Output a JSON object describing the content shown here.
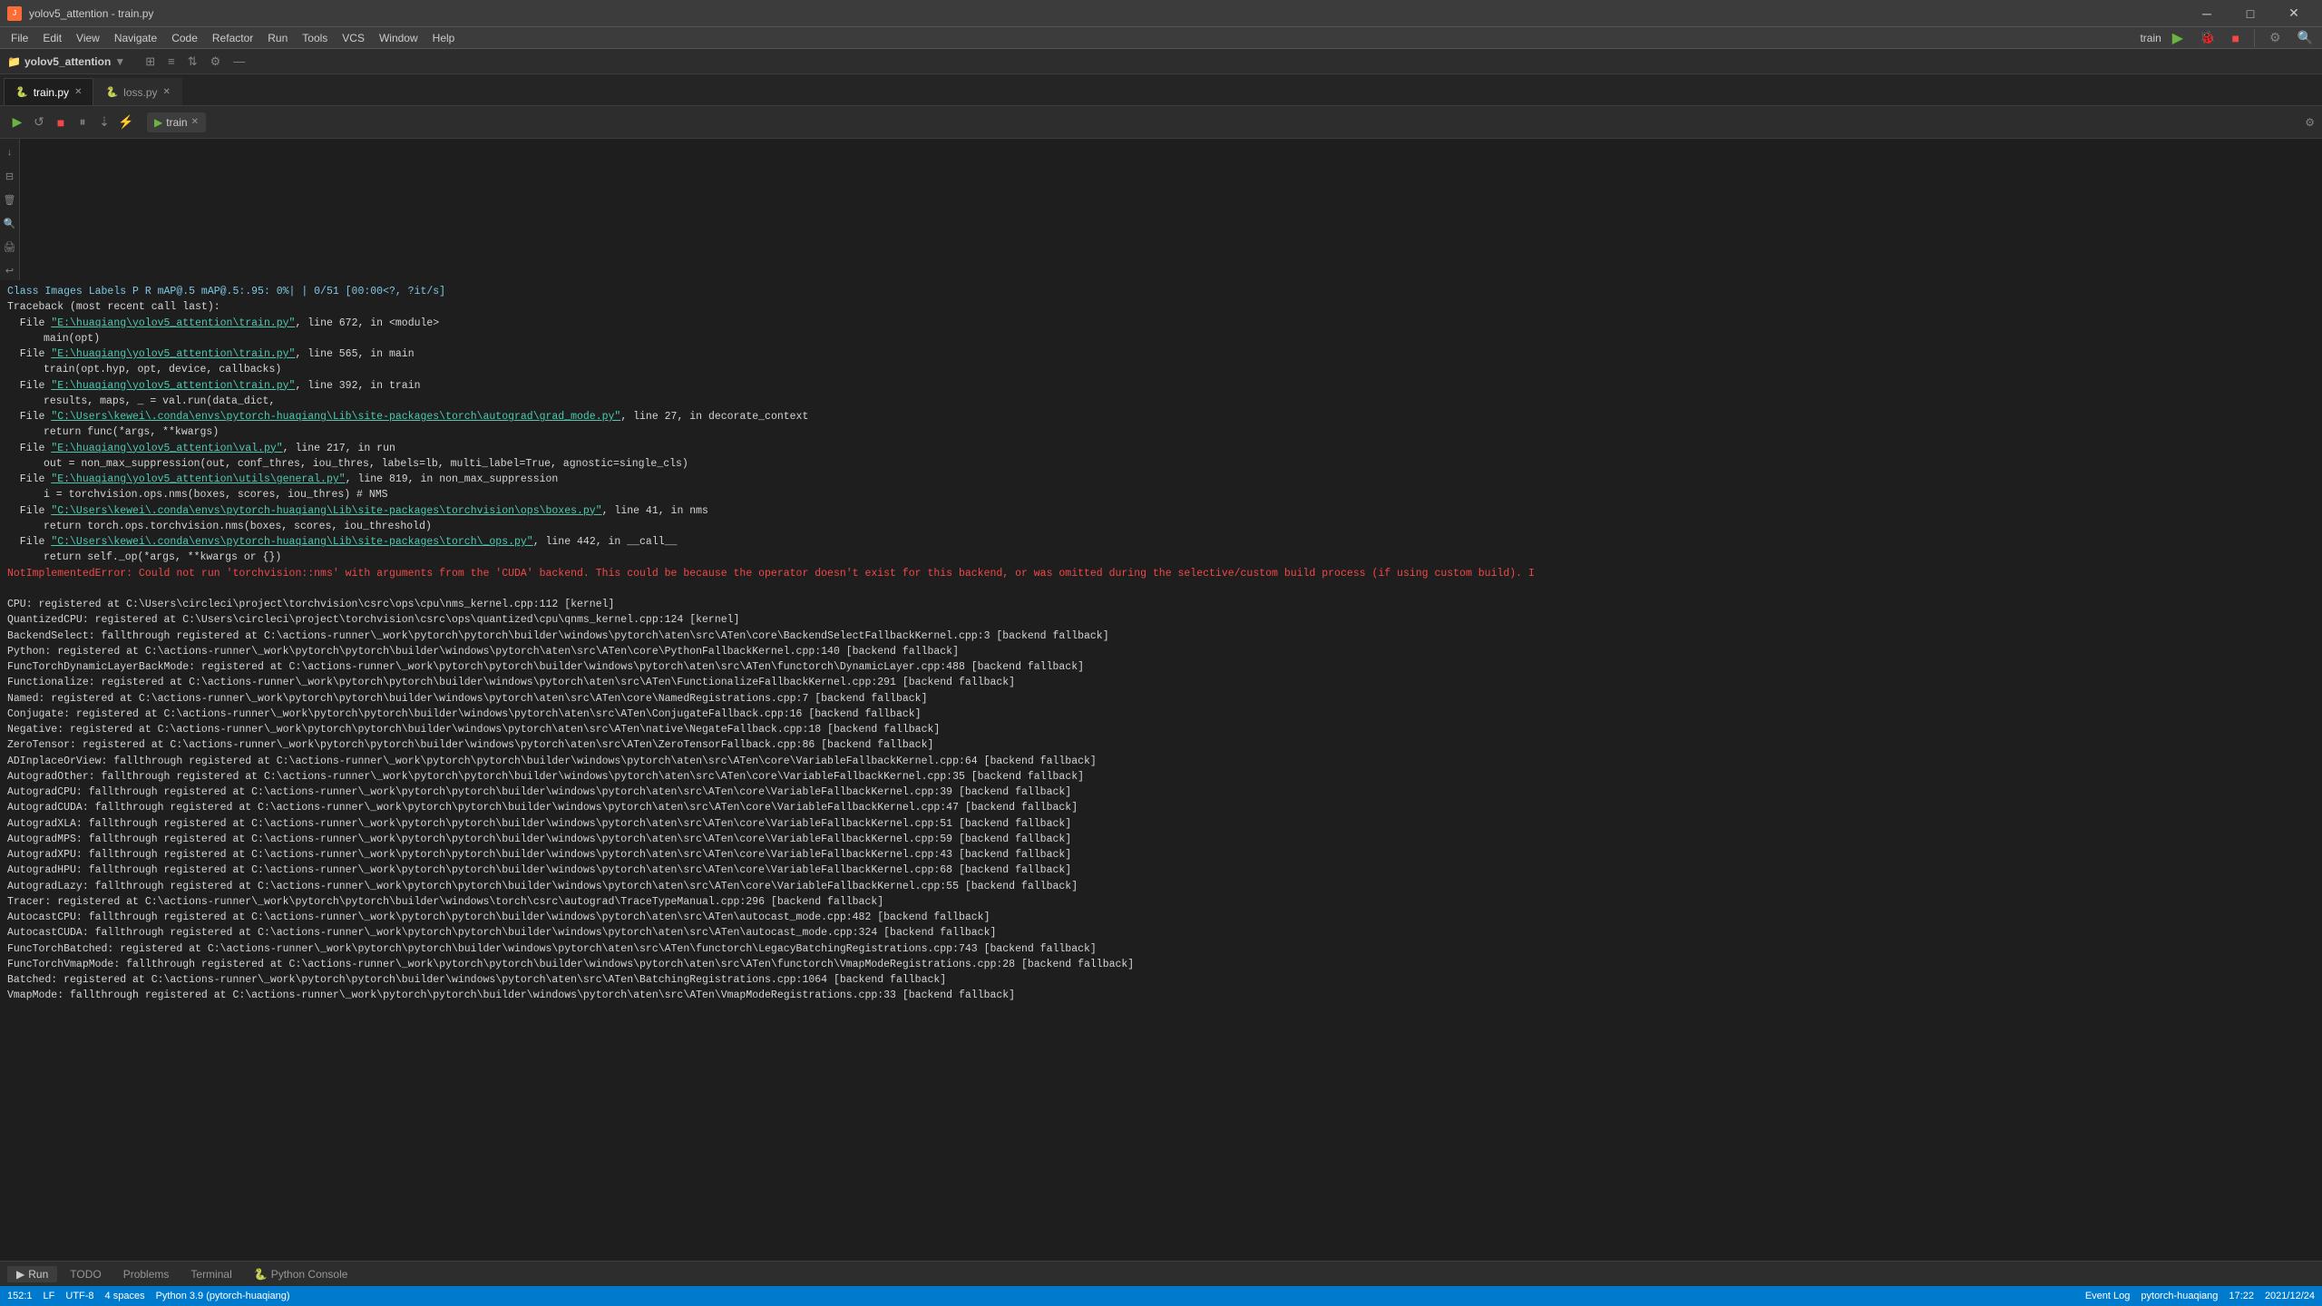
{
  "window": {
    "title": "yolov5_attention - train.py",
    "app_name": "yolov5_attention",
    "file_name": "train.py"
  },
  "menu": {
    "items": [
      "File",
      "Edit",
      "View",
      "Navigate",
      "Code",
      "Refactor",
      "Run",
      "Tools",
      "VCS",
      "Window",
      "Help"
    ]
  },
  "tabs": [
    {
      "label": "train.py",
      "icon": "py",
      "active": true
    },
    {
      "label": "loss.py",
      "icon": "py",
      "active": false
    }
  ],
  "run_panel": {
    "tab_label": "train",
    "run_label": "Run",
    "gear_label": "⚙"
  },
  "run_config": {
    "name": "train",
    "run_icon": "▶",
    "stop_icon": "■",
    "debug_icon": "🐛",
    "settings_icon": "⚙"
  },
  "output": {
    "header": "          Class     Images     Labels          P          R     mAP@.5  mAP@.5:.95:   0%|          | 0/51 [00:00<?, ?it/s]",
    "lines": [
      {
        "type": "normal",
        "text": "Traceback (most recent call last):"
      },
      {
        "type": "file-link",
        "prefix": "  File ",
        "link": "\"E:\\huaqiang\\yolov5_attention\\train.py\"",
        "suffix": ", line 672, in <module>"
      },
      {
        "type": "indent",
        "text": "main(opt)"
      },
      {
        "type": "file-link",
        "prefix": "  File ",
        "link": "\"E:\\huaqiang\\yolov5_attention\\train.py\"",
        "suffix": ", line 565, in main"
      },
      {
        "type": "indent",
        "text": "train(opt.hyp, opt, device, callbacks)"
      },
      {
        "type": "file-link",
        "prefix": "  File ",
        "link": "\"E:\\huaqiang\\yolov5_attention\\train.py\"",
        "suffix": ", line 392, in train"
      },
      {
        "type": "indent",
        "text": "results, maps, _ = val.run(data_dict,"
      },
      {
        "type": "file-link",
        "prefix": "  File ",
        "link": "\"C:\\Users\\kewei\\.conda\\envs\\pytorch-huaqiang\\Lib\\site-packages\\torch\\autograd\\grad_mode.py\"",
        "suffix": ", line 27, in decorate_context"
      },
      {
        "type": "indent",
        "text": "return func(*args, **kwargs)"
      },
      {
        "type": "file-link",
        "prefix": "  File ",
        "link": "\"E:\\huaqiang\\yolov5_attention\\val.py\"",
        "suffix": ", line 217, in run"
      },
      {
        "type": "indent",
        "text": "out = non_max_suppression(out, conf_thres, iou_thres, labels=lb, multi_label=True, agnostic=single_cls)"
      },
      {
        "type": "file-link",
        "prefix": "  File ",
        "link": "\"E:\\huaqiang\\yolov5_attention\\utils\\general.py\"",
        "suffix": ", line 819, in non_max_suppression"
      },
      {
        "type": "indent",
        "text": "i = torchvision.ops.nms(boxes, scores, iou_thres)  # NMS"
      },
      {
        "type": "file-link",
        "prefix": "  File ",
        "link": "\"C:\\Users\\kewei\\.conda\\envs\\pytorch-huaqiang\\Lib\\site-packages\\torchvision\\ops\\boxes.py\"",
        "suffix": ", line 41, in nms"
      },
      {
        "type": "indent",
        "text": "return torch.ops.torchvision.nms(boxes, scores, iou_threshold)"
      },
      {
        "type": "file-link",
        "prefix": "  File ",
        "link": "\"C:\\Users\\kewei\\.conda\\envs\\pytorch-huaqiang\\Lib\\site-packages\\torch\\_ops.py\"",
        "suffix": ", line 442, in __call__"
      },
      {
        "type": "indent",
        "text": "return self._op(*args, **kwargs or {})"
      },
      {
        "type": "error",
        "text": "NotImplementedError: Could not run 'torchvision::nms' with arguments from the 'CUDA' backend. This could be because the operator doesn't exist for this backend, or was omitted during the selective/custom build process (if using custom build). I"
      },
      {
        "type": "blank"
      },
      {
        "type": "reg",
        "text": "CPU: registered at C:\\Users\\circleci\\project\\torchvision\\csrc\\ops\\cpu\\nms_kernel.cpp:112 [kernel]"
      },
      {
        "type": "reg",
        "text": "QuantizedCPU: registered at C:\\Users\\circleci\\project\\torchvision\\csrc\\ops\\quantized\\cpu\\qnms_kernel.cpp:124 [kernel]"
      },
      {
        "type": "reg",
        "text": "BackendSelect: fallthrough registered at C:\\actions-runner\\_work\\pytorch\\pytorch\\builder\\windows\\pytorch\\aten\\src\\ATen\\core\\BackendSelectFallbackKernel.cpp:3 [backend fallback]"
      },
      {
        "type": "reg",
        "text": "Python: registered at C:\\actions-runner\\_work\\pytorch\\pytorch\\builder\\windows\\pytorch\\aten\\src\\ATen\\core\\PythonFallbackKernel.cpp:140 [backend fallback]"
      },
      {
        "type": "reg",
        "text": "FuncTorchDynamicLayerBackMode: registered at C:\\actions-runner\\_work\\pytorch\\pytorch\\builder\\windows\\pytorch\\aten\\src\\ATen\\functorch\\DynamicLayer.cpp:488 [backend fallback]"
      },
      {
        "type": "reg",
        "text": "Functionalize: registered at C:\\actions-runner\\_work\\pytorch\\pytorch\\builder\\windows\\pytorch\\aten\\src\\ATen\\FunctionalizeFallbackKernel.cpp:291 [backend fallback]"
      },
      {
        "type": "reg",
        "text": "Named: registered at C:\\actions-runner\\_work\\pytorch\\pytorch\\builder\\windows\\pytorch\\aten\\src\\ATen\\core\\NamedRegistrations.cpp:7 [backend fallback]"
      },
      {
        "type": "reg",
        "text": "Conjugate: registered at C:\\actions-runner\\_work\\pytorch\\pytorch\\builder\\windows\\pytorch\\aten\\src\\ATen\\ConjugateFallback.cpp:16 [backend fallback]"
      },
      {
        "type": "reg",
        "text": "Negative: registered at C:\\actions-runner\\_work\\pytorch\\pytorch\\builder\\windows\\pytorch\\aten\\src\\ATen\\native\\NegateFallback.cpp:18 [backend fallback]"
      },
      {
        "type": "reg",
        "text": "ZeroTensor: registered at C:\\actions-runner\\_work\\pytorch\\pytorch\\builder\\windows\\pytorch\\aten\\src\\ATen\\ZeroTensorFallback.cpp:86 [backend fallback]"
      },
      {
        "type": "reg",
        "text": "ADInplaceOrView: fallthrough registered at C:\\actions-runner\\_work\\pytorch\\pytorch\\builder\\windows\\pytorch\\aten\\src\\ATen\\core\\VariableFallbackKernel.cpp:64 [backend fallback]"
      },
      {
        "type": "reg",
        "text": "AutogradOther: fallthrough registered at C:\\actions-runner\\_work\\pytorch\\pytorch\\builder\\windows\\pytorch\\aten\\src\\ATen\\core\\VariableFallbackKernel.cpp:35 [backend fallback]"
      },
      {
        "type": "reg",
        "text": "AutogradCPU: fallthrough registered at C:\\actions-runner\\_work\\pytorch\\pytorch\\builder\\windows\\pytorch\\aten\\src\\ATen\\core\\VariableFallbackKernel.cpp:39 [backend fallback]"
      },
      {
        "type": "reg",
        "text": "AutogradCUDA: fallthrough registered at C:\\actions-runner\\_work\\pytorch\\pytorch\\builder\\windows\\pytorch\\aten\\src\\ATen\\core\\VariableFallbackKernel.cpp:47 [backend fallback]"
      },
      {
        "type": "reg",
        "text": "AutogradXLA: fallthrough registered at C:\\actions-runner\\_work\\pytorch\\pytorch\\builder\\windows\\pytorch\\aten\\src\\ATen\\core\\VariableFallbackKernel.cpp:51 [backend fallback]"
      },
      {
        "type": "reg",
        "text": "AutogradMPS: fallthrough registered at C:\\actions-runner\\_work\\pytorch\\pytorch\\builder\\windows\\pytorch\\aten\\src\\ATen\\core\\VariableFallbackKernel.cpp:59 [backend fallback]"
      },
      {
        "type": "reg",
        "text": "AutogradXPU: fallthrough registered at C:\\actions-runner\\_work\\pytorch\\pytorch\\builder\\windows\\pytorch\\aten\\src\\ATen\\core\\VariableFallbackKernel.cpp:43 [backend fallback]"
      },
      {
        "type": "reg",
        "text": "AutogradHPU: fallthrough registered at C:\\actions-runner\\_work\\pytorch\\pytorch\\builder\\windows\\pytorch\\aten\\src\\ATen\\core\\VariableFallbackKernel.cpp:68 [backend fallback]"
      },
      {
        "type": "reg",
        "text": "AutogradLazy: fallthrough registered at C:\\actions-runner\\_work\\pytorch\\pytorch\\builder\\windows\\pytorch\\aten\\src\\ATen\\core\\VariableFallbackKernel.cpp:55 [backend fallback]"
      },
      {
        "type": "reg",
        "text": "Tracer: registered at C:\\actions-runner\\_work\\pytorch\\pytorch\\builder\\windows\\torch\\csrc\\autograd\\TraceTypeManual.cpp:296 [backend fallback]"
      },
      {
        "type": "reg",
        "text": "AutocastCPU: fallthrough registered at C:\\actions-runner\\_work\\pytorch\\pytorch\\builder\\windows\\pytorch\\aten\\src\\ATen\\autocast_mode.cpp:482 [backend fallback]"
      },
      {
        "type": "reg",
        "text": "AutocastCUDA: fallthrough registered at C:\\actions-runner\\_work\\pytorch\\pytorch\\builder\\windows\\pytorch\\aten\\src\\ATen\\autocast_mode.cpp:324 [backend fallback]"
      },
      {
        "type": "reg",
        "text": "FuncTorchBatched: registered at C:\\actions-runner\\_work\\pytorch\\pytorch\\builder\\windows\\pytorch\\aten\\src\\ATen\\functorch\\LegacyBatchingRegistrations.cpp:743 [backend fallback]"
      },
      {
        "type": "reg",
        "text": "FuncTorchVmapMode: fallthrough registered at C:\\actions-runner\\_work\\pytorch\\pytorch\\builder\\windows\\pytorch\\aten\\src\\ATen\\functorch\\VmapModeRegistrations.cpp:28 [backend fallback]"
      },
      {
        "type": "reg",
        "text": "Batched: registered at C:\\actions-runner\\_work\\pytorch\\pytorch\\builder\\windows\\pytorch\\aten\\src\\ATen\\BatchingRegistrations.cpp:1064 [backend fallback]"
      },
      {
        "type": "reg",
        "text": "VmapMode: fallthrough registered at C:\\actions-runner\\_work\\pytorch\\pytorch\\builder\\windows\\pytorch\\aten\\src\\ATen\\VmapModeRegistrations.cpp:33 [backend fallback]"
      }
    ]
  },
  "bottom_tabs": [
    "Run",
    "TODO",
    "Problems",
    "Terminal",
    "Python Console"
  ],
  "status_bar": {
    "left": [
      "152:1",
      "LF",
      "UTF-8",
      "4 spaces",
      "Python 3.9 (pytorch-huaqiang)"
    ],
    "right": [
      "Event Log",
      "pytorch-huaqiang",
      "17:22",
      "2021/12/24"
    ]
  },
  "icons": {
    "play": "▶",
    "stop": "■",
    "rerun": "↺",
    "debug": "🐞",
    "pause": "⏸",
    "step": "⇣",
    "settings": "⚙",
    "close": "✕",
    "folder": "📁",
    "expand": "▼",
    "structure": "⊞",
    "favorites": "★"
  }
}
